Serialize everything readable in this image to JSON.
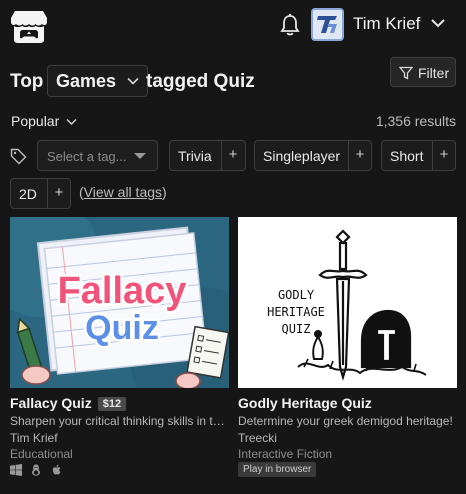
{
  "header": {
    "logo_icon": "itch-io-logo-icon",
    "notifications_icon": "bell-icon",
    "username": "Tim Krief",
    "menu_icon": "chevron-down-icon"
  },
  "title": {
    "prefix": "Top",
    "category": "Games",
    "suffix": "tagged Quiz",
    "filter_label": "Filter"
  },
  "sort": {
    "label": "Popular",
    "results": "1,356 results"
  },
  "tags": {
    "placeholder": "Select a tag...",
    "items": [
      {
        "name": "Trivia"
      },
      {
        "name": "Singleplayer"
      },
      {
        "name": "Short"
      },
      {
        "name": "2D"
      }
    ],
    "plus": "+",
    "view_all": "View all tags",
    "open_paren": "(",
    "close_paren": ")"
  },
  "games": [
    {
      "title": "Fallacy Quiz",
      "price": "$12",
      "description": "Sharpen your critical thinking skills in this game",
      "author": "Tim Krief",
      "genre": "Educational",
      "platforms": [
        "windows-icon",
        "linux-icon",
        "apple-icon"
      ],
      "cover_text": [
        "Fallacy",
        "Quiz"
      ]
    },
    {
      "title": "Godly Heritage Quiz",
      "description": "Determine your greek demigod heritage!",
      "author": "Treecki",
      "genre": "Interactive Fiction",
      "badge": "Play in browser",
      "cover_text": [
        "GODLY",
        "HERITAGE",
        "QUIZ"
      ]
    }
  ],
  "colors": {
    "background": "#161616",
    "text": "#eaeaea",
    "muted": "#b8b8b8",
    "border": "#3e3e3e",
    "fallacy_pink": "#f0547a",
    "quiz_blue": "#5c8fe6"
  }
}
